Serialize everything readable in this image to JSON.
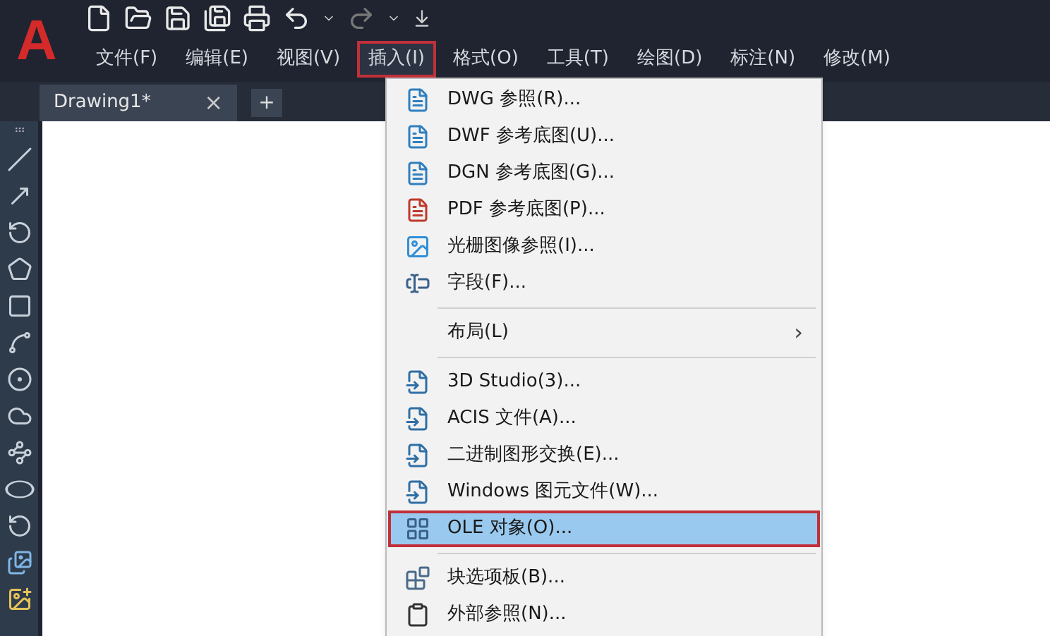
{
  "app": {
    "logo": "A"
  },
  "menubar": [
    {
      "label": "文件(F)",
      "selected": false
    },
    {
      "label": "编辑(E)",
      "selected": false
    },
    {
      "label": "视图(V)",
      "selected": false
    },
    {
      "label": "插入(I)",
      "selected": true
    },
    {
      "label": "格式(O)",
      "selected": false
    },
    {
      "label": "工具(T)",
      "selected": false
    },
    {
      "label": "绘图(D)",
      "selected": false
    },
    {
      "label": "标注(N)",
      "selected": false
    },
    {
      "label": "修改(M)",
      "selected": false
    }
  ],
  "tabs": [
    {
      "label": "Drawing1*",
      "selected": true,
      "close": "×"
    }
  ],
  "new_tab": "+",
  "menu": [
    {
      "kind": "ref",
      "label": "DWG 参照(R)...",
      "selected": false
    },
    {
      "kind": "ref",
      "label": "DWF 参考底图(U)...",
      "selected": false
    },
    {
      "kind": "ref",
      "label": "DGN 参考底图(G)...",
      "selected": false
    },
    {
      "kind": "pdf",
      "label": "PDF 参考底图(P)...",
      "selected": false
    },
    {
      "kind": "image",
      "label": "光栅图像参照(I)...",
      "selected": false
    },
    {
      "kind": "field",
      "label": "字段(F)...",
      "selected": false
    },
    {
      "kind": "separator"
    },
    {
      "kind": "submenu",
      "label": "布局(L)",
      "arrow": "›",
      "selected": false
    },
    {
      "kind": "separator"
    },
    {
      "kind": "import",
      "label": "3D Studio(3)...",
      "selected": false
    },
    {
      "kind": "import",
      "label": "ACIS 文件(A)...",
      "selected": false
    },
    {
      "kind": "import",
      "label": "二进制图形交换(E)...",
      "selected": false
    },
    {
      "kind": "import",
      "label": "Windows 图元文件(W)...",
      "selected": false
    },
    {
      "kind": "ole",
      "label": "OLE 对象(O)...",
      "selected": true
    },
    {
      "kind": "separator"
    },
    {
      "kind": "palette",
      "label": "块选项板(B)...",
      "selected": false
    },
    {
      "kind": "clipboard",
      "label": "外部参照(N)...",
      "selected": false
    }
  ]
}
